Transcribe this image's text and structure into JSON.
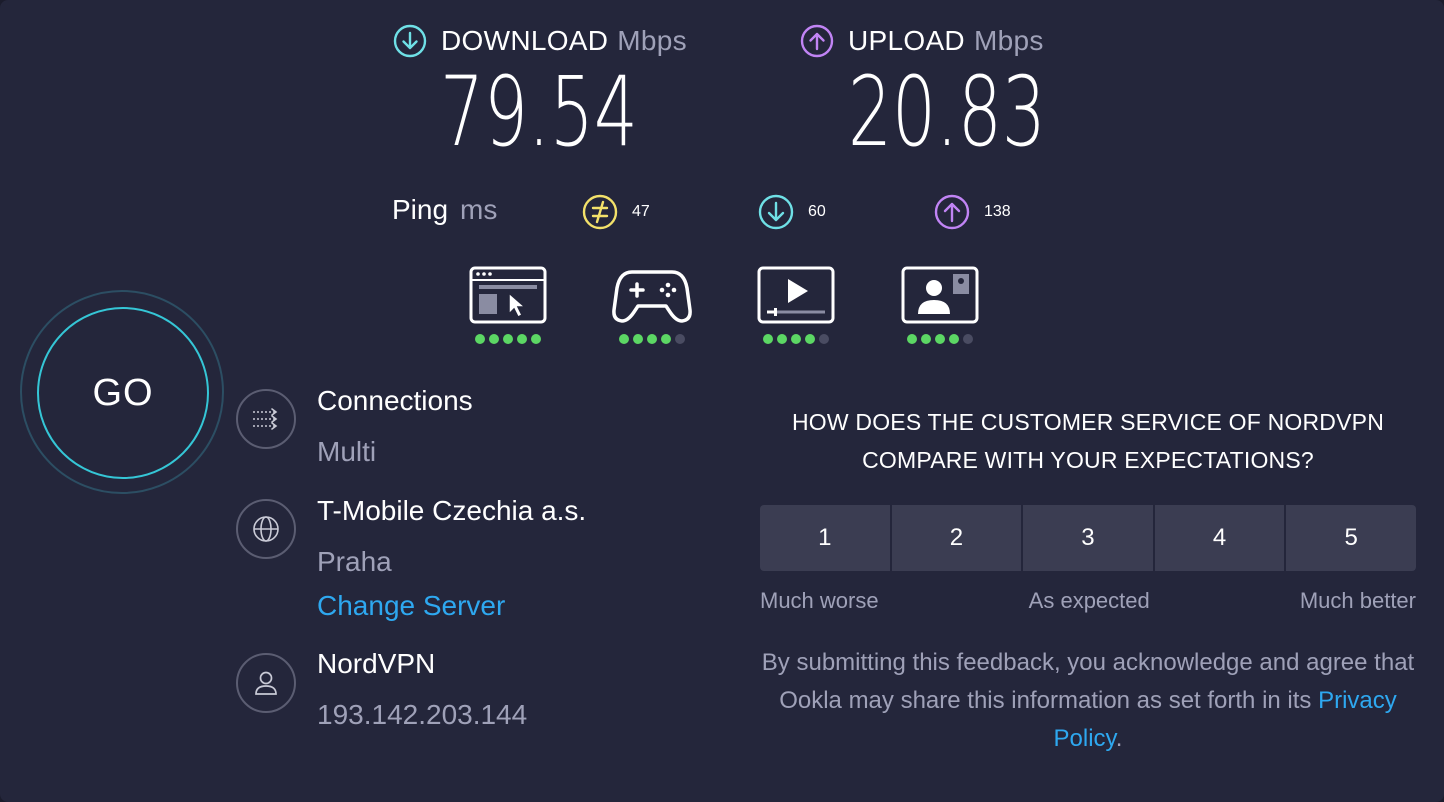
{
  "download": {
    "label": "DOWNLOAD",
    "unit": "Mbps",
    "value": "79.54"
  },
  "upload": {
    "label": "UPLOAD",
    "unit": "Mbps",
    "value": "20.83"
  },
  "ping": {
    "label": "Ping",
    "unit": "ms",
    "idle": "47",
    "download": "60",
    "upload": "138"
  },
  "activities": [
    {
      "icon": "web-browsing-icon",
      "rating": 5
    },
    {
      "icon": "gaming-icon",
      "rating": 4
    },
    {
      "icon": "video-streaming-icon",
      "rating": 4
    },
    {
      "icon": "video-chat-icon",
      "rating": 4
    }
  ],
  "go_label": "GO",
  "connections": {
    "title": "Connections",
    "value": "Multi"
  },
  "server": {
    "title": "T-Mobile Czechia a.s.",
    "location": "Praha",
    "change_label": "Change Server"
  },
  "provider": {
    "title": "NordVPN",
    "ip": "193.142.203.144"
  },
  "survey": {
    "question": "HOW DOES THE CUSTOMER SERVICE OF NORDVPN COMPARE WITH YOUR EXPECTATIONS?",
    "options": [
      "1",
      "2",
      "3",
      "4",
      "5"
    ],
    "scale_low": "Much worse",
    "scale_mid": "As expected",
    "scale_high": "Much better",
    "disclaimer": "By submitting this feedback, you acknowledge and agree that Ookla may share this information as set forth in its",
    "privacy_link": "Privacy Policy",
    "period": "."
  },
  "colors": {
    "download": "#6fe0e6",
    "upload": "#c184f5",
    "ping": "#f3e16a",
    "accent": "#2ea8f0",
    "go_ring": "#35c6d6"
  }
}
